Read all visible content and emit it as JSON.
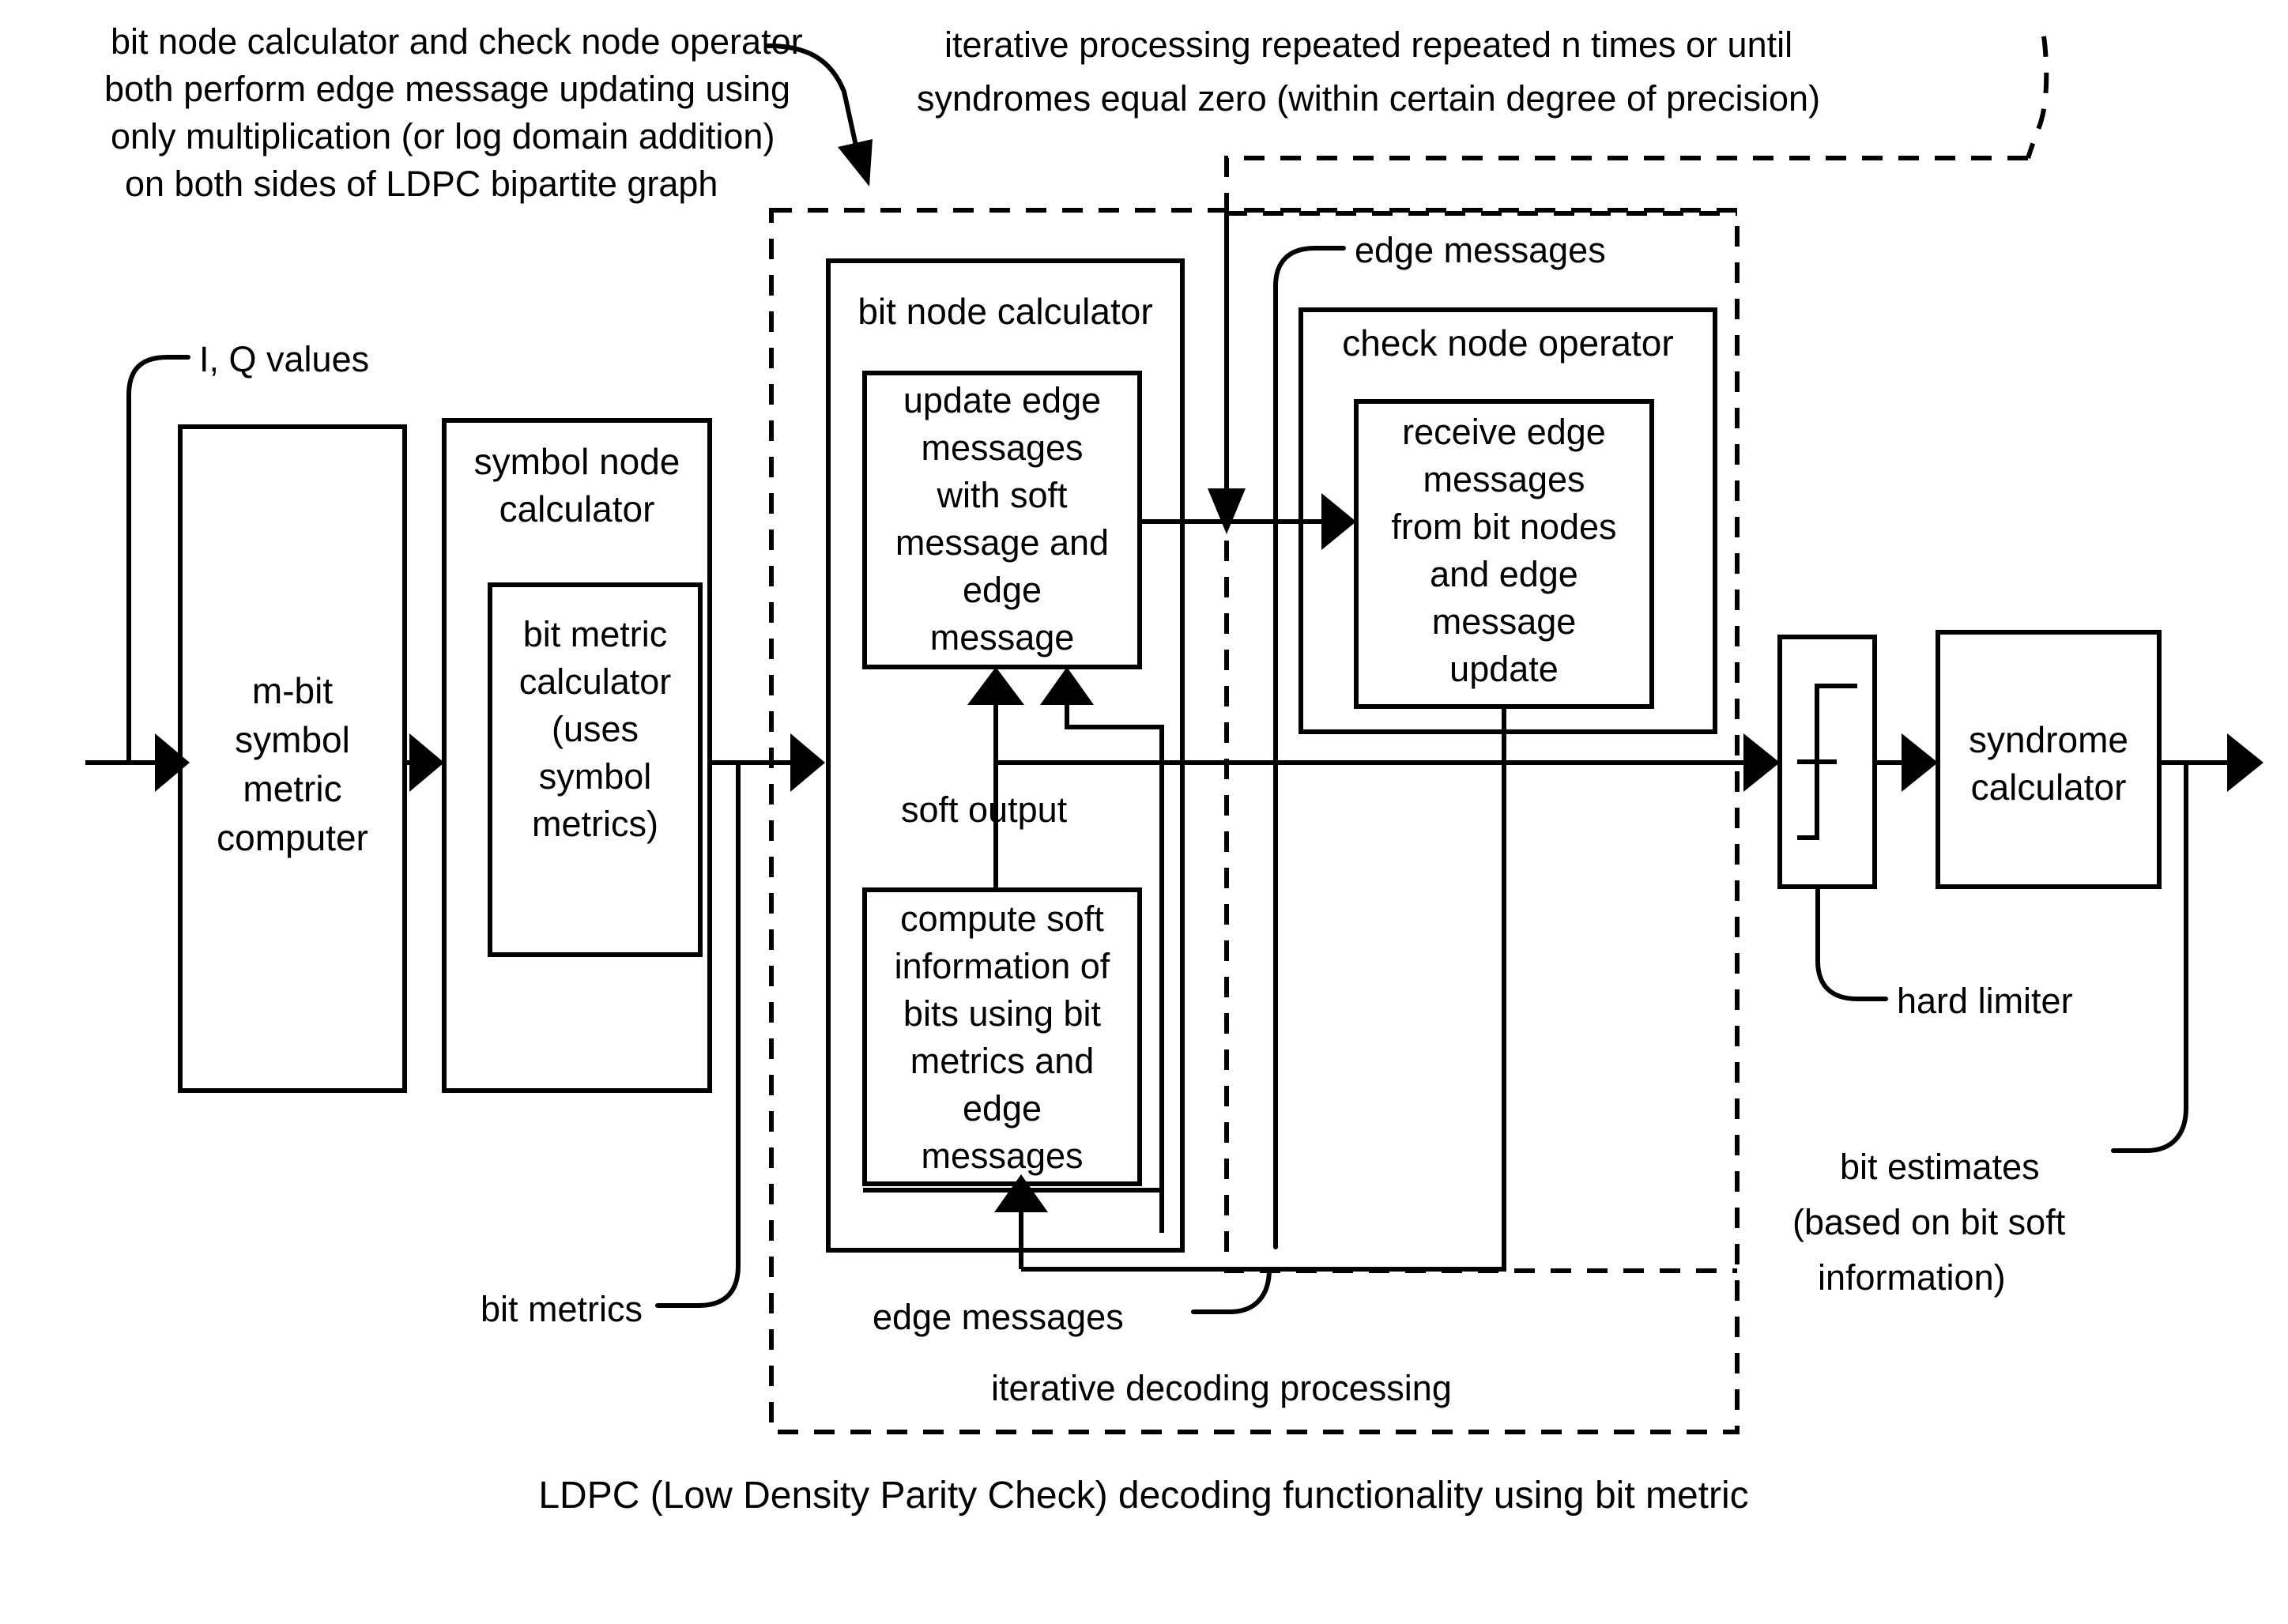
{
  "figure": {
    "caption": "LDPC (Low Density Parity Check) decoding functionality using bit metric",
    "annotations": {
      "left_note": [
        "bit node calculator and check node operator",
        "both perform edge message updating using",
        "only multiplication (or log domain addition)",
        "on both sides of LDPC bipartite graph"
      ],
      "top_note": [
        "iterative processing repeated repeated n times or until",
        "syndromes equal zero (within certain degree of precision)"
      ],
      "bit_estimates": [
        "bit estimates",
        "(based on bit soft",
        "information)"
      ]
    },
    "signal_labels": {
      "input": "I, Q values",
      "bit_metrics": "bit metrics",
      "soft_output": "soft output",
      "edge_messages_top": "edge messages",
      "edge_messages_bottom": "edge messages",
      "hard_limiter": "hard limiter"
    },
    "dashed_regions": {
      "iterative_decoding": "iterative decoding processing"
    },
    "blocks": {
      "symbol_metric_computer": [
        "m-bit",
        "symbol",
        "metric",
        "computer"
      ],
      "symbol_node_calculator": [
        "symbol node",
        "calculator"
      ],
      "bit_metric_calculator": [
        "bit metric",
        "calculator",
        "(uses",
        "symbol",
        "metrics)"
      ],
      "bit_node_calculator": [
        "bit node calculator"
      ],
      "update_edge_messages": [
        "update edge",
        "messages",
        "with soft",
        "message and",
        "edge",
        "message"
      ],
      "compute_soft_information": [
        "compute soft",
        "information of",
        "bits using bit",
        "metrics and",
        "edge",
        "messages"
      ],
      "check_node_operator": [
        "check node operator"
      ],
      "receive_edge_messages": [
        "receive edge",
        "messages",
        "from bit nodes",
        "and edge",
        "message",
        "update"
      ],
      "hard_limiter": [],
      "syndrome_calculator": [
        "syndrome",
        "calculator"
      ]
    },
    "colors": {
      "stroke": "#000000",
      "background": "#ffffff"
    }
  }
}
